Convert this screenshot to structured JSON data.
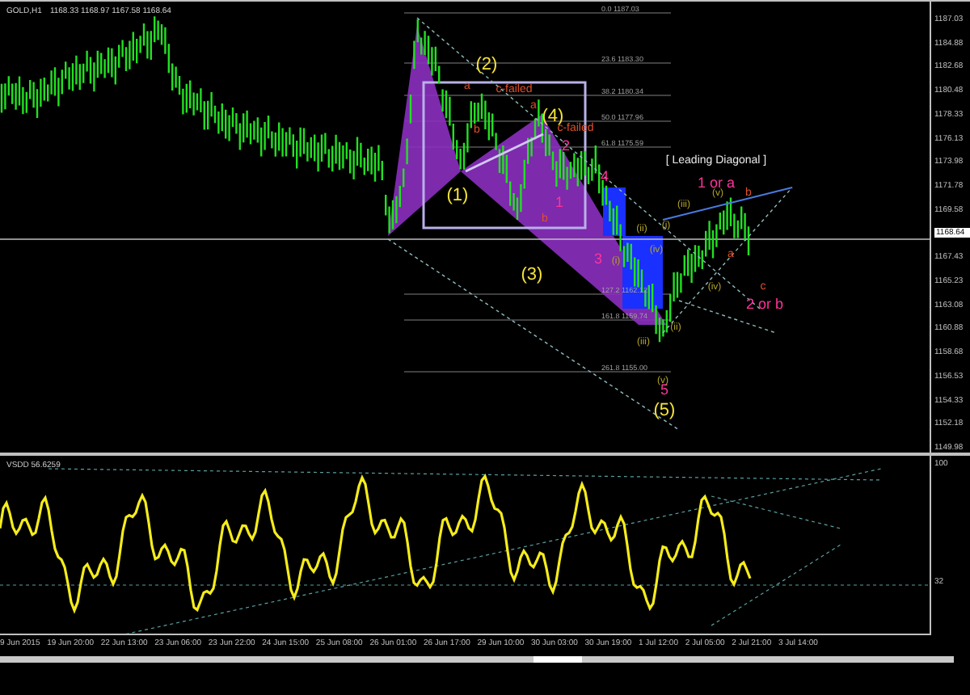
{
  "chart": {
    "symbol": "GOLD,H1",
    "quote": "1168.33 1168.97 1167.58 1168.64"
  },
  "fib_levels": [
    {
      "label": "0.0 1187.03"
    },
    {
      "label": "23.6 1183.30"
    },
    {
      "label": "38.2 1180.34"
    },
    {
      "label": "50.0 1177.96"
    },
    {
      "label": "61.8 1175.59"
    },
    {
      "label": "127.2 1162.12"
    },
    {
      "label": "161.8 1159.74"
    },
    {
      "label": "261.8 1155.00"
    }
  ],
  "wave_labels": [
    {
      "text": "(2)",
      "kind": "major"
    },
    {
      "text": "(1)",
      "kind": "major"
    },
    {
      "text": "(4)",
      "kind": "major"
    },
    {
      "text": "(3)",
      "kind": "major"
    },
    {
      "text": "(5)",
      "kind": "major"
    },
    {
      "text": "2",
      "kind": "minor"
    },
    {
      "text": "1",
      "kind": "minor"
    },
    {
      "text": "4",
      "kind": "minor"
    },
    {
      "text": "3",
      "kind": "minor"
    },
    {
      "text": "5",
      "kind": "minor"
    },
    {
      "text": "1 or a",
      "kind": "minor"
    },
    {
      "text": "2 or b",
      "kind": "minor"
    },
    {
      "text": "c-failed",
      "kind": "sub"
    },
    {
      "text": "c-failed",
      "kind": "sub"
    },
    {
      "text": "a",
      "kind": "sub"
    },
    {
      "text": "b",
      "kind": "sub"
    },
    {
      "text": "a",
      "kind": "sub"
    },
    {
      "text": "b",
      "kind": "sub"
    },
    {
      "text": "b",
      "kind": "sub"
    },
    {
      "text": "a",
      "kind": "sub"
    },
    {
      "text": "c",
      "kind": "sub"
    },
    {
      "text": "(ii)",
      "kind": "minute"
    },
    {
      "text": "(i)",
      "kind": "minute"
    },
    {
      "text": "(iii)",
      "kind": "minute"
    },
    {
      "text": "(v)",
      "kind": "minute"
    },
    {
      "text": "(iv)",
      "kind": "minute"
    },
    {
      "text": "(i)",
      "kind": "minute"
    },
    {
      "text": "(iii)",
      "kind": "minute"
    },
    {
      "text": "(ii)",
      "kind": "minute"
    },
    {
      "text": "(iv)",
      "kind": "minute"
    },
    {
      "text": "(v)",
      "kind": "minute"
    },
    {
      "text": "[ Leading Diagonal ]",
      "kind": "note"
    }
  ],
  "price_axis": [
    {
      "label": "1187.03",
      "current": false
    },
    {
      "label": "1184.88",
      "current": false
    },
    {
      "label": "1182.68",
      "current": false
    },
    {
      "label": "1180.48",
      "current": false
    },
    {
      "label": "1178.33",
      "current": false
    },
    {
      "label": "1176.13",
      "current": false
    },
    {
      "label": "1173.98",
      "current": false
    },
    {
      "label": "1171.78",
      "current": false
    },
    {
      "label": "1169.58",
      "current": false
    },
    {
      "label": "1168.64",
      "current": true
    },
    {
      "label": "1167.43",
      "current": false
    },
    {
      "label": "1165.23",
      "current": false
    },
    {
      "label": "1163.08",
      "current": false
    },
    {
      "label": "1160.88",
      "current": false
    },
    {
      "label": "1158.68",
      "current": false
    },
    {
      "label": "1156.53",
      "current": false
    },
    {
      "label": "1154.33",
      "current": false
    },
    {
      "label": "1152.18",
      "current": false
    },
    {
      "label": "1149.98",
      "current": false
    }
  ],
  "indicator": {
    "name": "VSDD 56.6259",
    "axis": [
      "100",
      "32"
    ]
  },
  "time_axis": [
    "9 Jun 2015",
    "19 Jun 20:00",
    "22 Jun 13:00",
    "23 Jun 06:00",
    "23 Jun 22:00",
    "24 Jun 15:00",
    "25 Jun 08:00",
    "26 Jun 01:00",
    "26 Jun 17:00",
    "29 Jun 10:00",
    "30 Jun 03:00",
    "30 Jun 19:00",
    "1 Jul 12:00",
    "2 Jul 05:00",
    "2 Jul 21:00",
    "3 Jul 14:00"
  ]
}
